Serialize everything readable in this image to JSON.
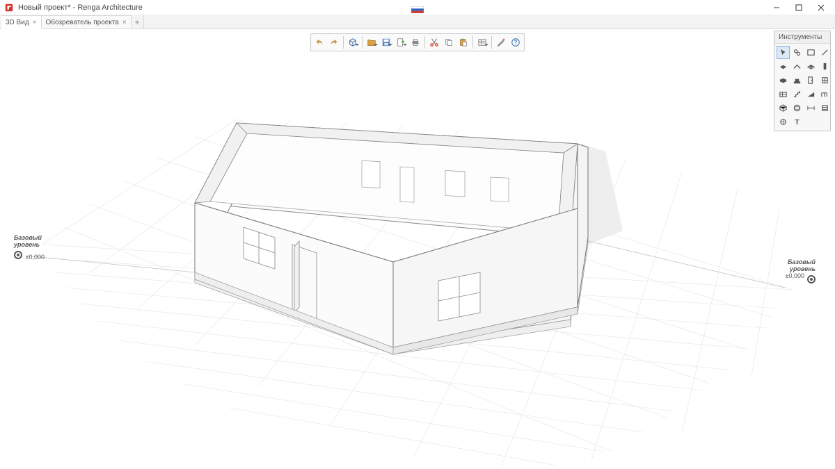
{
  "window": {
    "title": "Новый проект* - Renga Architecture"
  },
  "tabs": {
    "items": [
      {
        "label": "3D Вид",
        "active": true
      },
      {
        "label": "Обозреватель проекта",
        "active": false
      }
    ]
  },
  "toolbar": {
    "buttons": [
      "undo",
      "redo",
      "sep",
      "cube-view",
      "sep",
      "open",
      "save",
      "export",
      "print",
      "sep",
      "cut",
      "copy",
      "paste",
      "sep",
      "properties",
      "sep",
      "settings",
      "help"
    ]
  },
  "toolpanel": {
    "title": "Инструменты",
    "tools": [
      "select",
      "link",
      "wall",
      "line",
      "slab",
      "roof",
      "opening",
      "column",
      "beam",
      "foundation",
      "door",
      "window",
      "room",
      "stair",
      "ramp",
      "railing",
      "group",
      "model",
      "dimension",
      "level",
      "section",
      "text"
    ],
    "selected": "select"
  },
  "levels": {
    "left": {
      "label1": "Базовый",
      "label2": "уровень",
      "elev": "±0,000"
    },
    "right": {
      "label1": "Базовый",
      "label2": "уровень",
      "elev": "±0,000"
    }
  }
}
